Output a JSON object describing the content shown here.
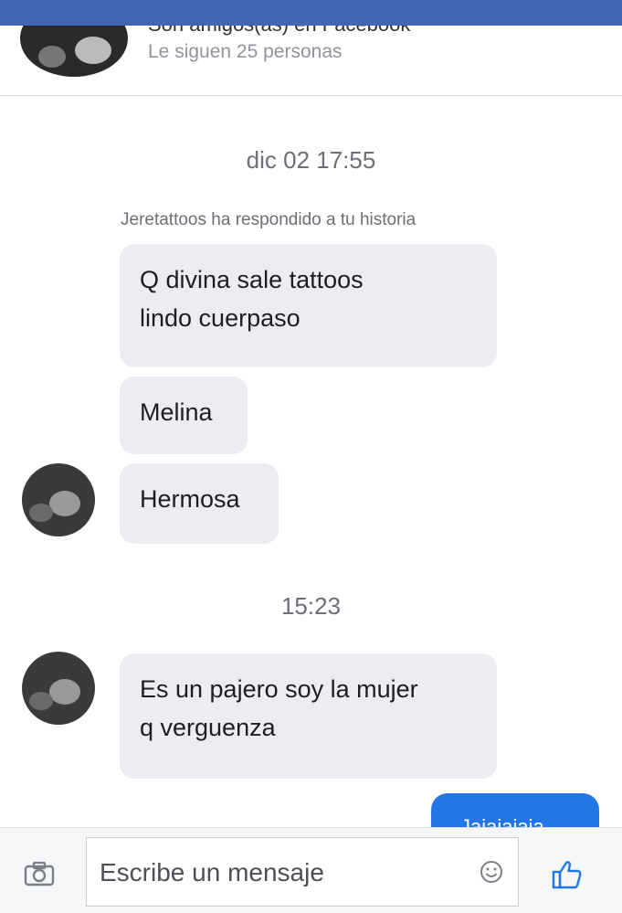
{
  "header": {
    "cut_line": "Son amigos(as) en Facebook",
    "followers": "Le siguen 25 personas"
  },
  "chat": {
    "timestamp_1": "dic 02 17:55",
    "story_note": "Jeretattoos ha respondido a tu historia",
    "messages_1": [
      {
        "lines": [
          "Q divina sale tattoos",
          "lindo cuerpaso"
        ]
      },
      {
        "lines": [
          "Melina"
        ]
      },
      {
        "lines": [
          "Hermosa"
        ]
      }
    ],
    "timestamp_2": "15:23",
    "messages_2": [
      {
        "lines": [
          "Es un pajero soy la mujer",
          "q verguenza"
        ]
      }
    ],
    "outgoing": "Jajajajaja"
  },
  "composer": {
    "placeholder": "Escribe un mensaje",
    "camera_icon": "camera-icon",
    "emoji_icon": "smiley-icon",
    "like_icon": "thumbs-up-icon"
  },
  "colors": {
    "brand_blue": "#4267b2",
    "outgoing_blue": "#2176e8",
    "bubble_gray": "#ebedf2"
  }
}
